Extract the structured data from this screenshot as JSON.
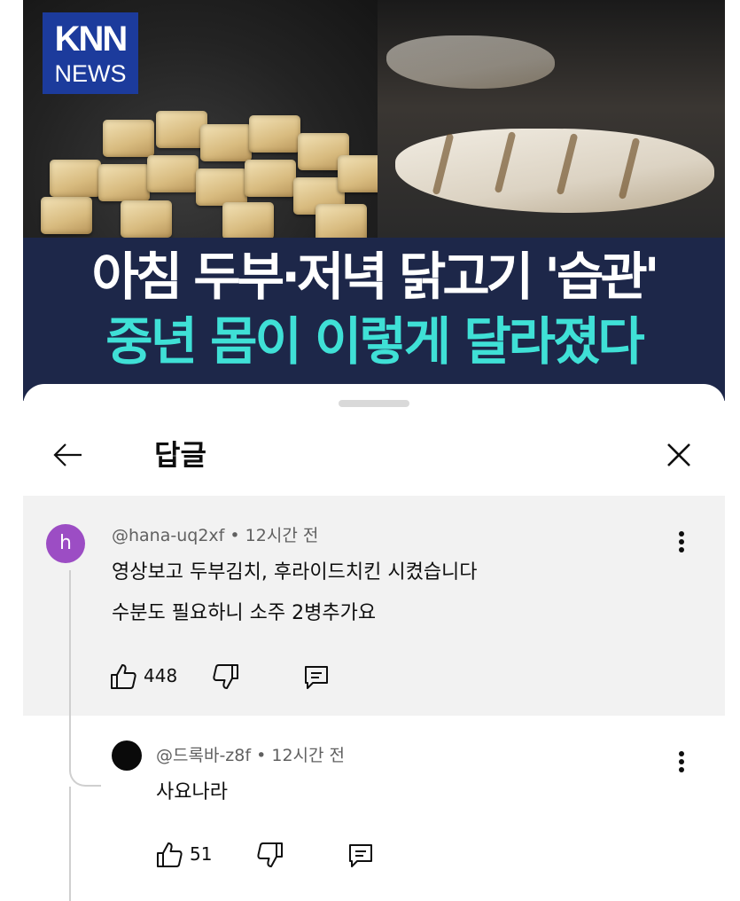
{
  "thumbnail": {
    "logo_top": "KNN",
    "logo_bottom": "NEWS",
    "headline_line1": "아침 두부·저녁 닭고기 '습관'",
    "headline_line2": "중년 몸이 이렇게 달라졌다",
    "headline_line2_color": "#3fe0d6"
  },
  "sheet": {
    "title": "답글",
    "back_icon": "arrow-left-icon",
    "close_icon": "close-icon"
  },
  "parent_comment": {
    "avatar_letter": "h",
    "avatar_color": "#9c4dc4",
    "author": "@hana-uq2xf",
    "separator": "•",
    "time": "12시간 전",
    "lines": [
      "영상보고 두부김치, 후라이드치킨 시켰습니다",
      "수분도 필요하니 소주 2병추가요"
    ],
    "like_count": "448",
    "icons": [
      "thumbs-up-icon",
      "thumbs-down-icon",
      "reply-icon",
      "more-vert-icon"
    ]
  },
  "reply": {
    "avatar_color": "#0a0a0a",
    "author": "@드록바-z8f",
    "separator": "•",
    "time": "12시간 전",
    "lines": [
      "사요나라"
    ],
    "like_count": "51",
    "icons": [
      "thumbs-up-icon",
      "thumbs-down-icon",
      "reply-icon",
      "more-vert-icon"
    ]
  }
}
